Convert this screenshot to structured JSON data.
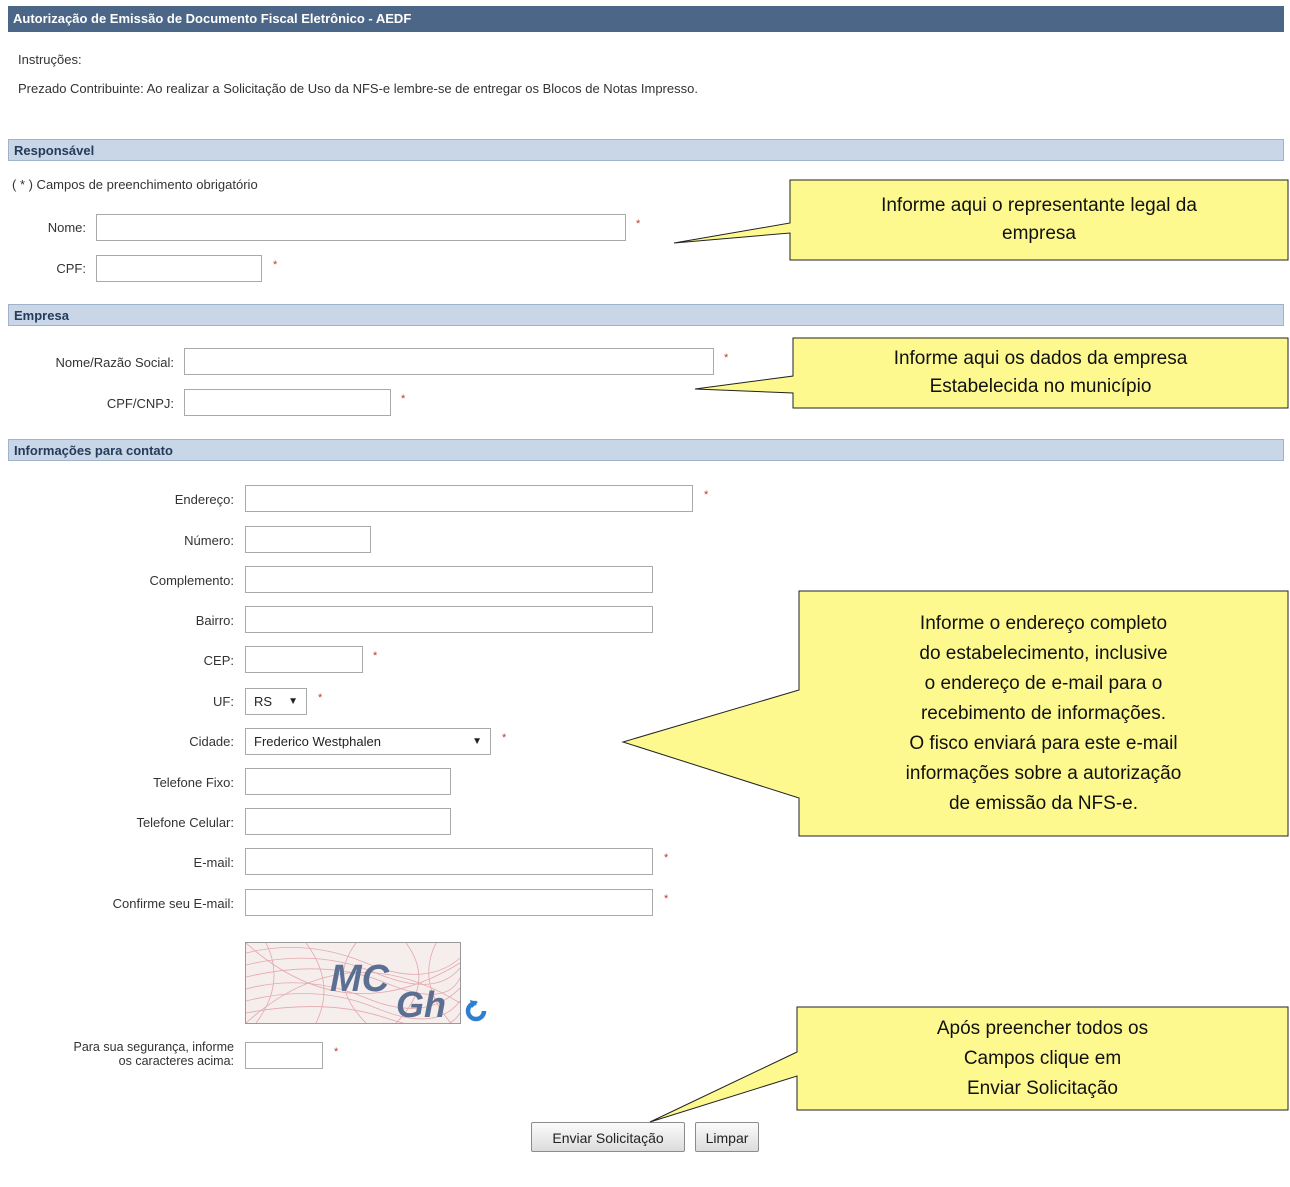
{
  "header": {
    "title": "Autorização de Emissão de Documento Fiscal Eletrônico - AEDF"
  },
  "instructions": {
    "label": "Instruções:",
    "text": "Prezado Contribuinte: Ao realizar a Solicitação de Uso da NFS-e lembre-se de entregar os Blocos de Notas Impresso."
  },
  "responsavel": {
    "section_title": "Responsável",
    "required_note": "( * ) Campos de preenchimento obrigatório",
    "nome_label": "Nome:",
    "cpf_label": "CPF:",
    "nome_value": "",
    "cpf_value": ""
  },
  "empresa": {
    "section_title": "Empresa",
    "razao_label": "Nome/Razão Social:",
    "cnpj_label": "CPF/CNPJ:",
    "razao_value": "",
    "cnpj_value": ""
  },
  "contato": {
    "section_title": "Informações para contato",
    "endereco_label": "Endereço:",
    "numero_label": "Número:",
    "complemento_label": "Complemento:",
    "bairro_label": "Bairro:",
    "cep_label": "CEP:",
    "uf_label": "UF:",
    "uf_value": "RS",
    "cidade_label": "Cidade:",
    "cidade_value": "Frederico Westphalen",
    "telefone_fixo_label": "Telefone Fixo:",
    "telefone_celular_label": "Telefone Celular:",
    "email_label": "E-mail:",
    "confirm_email_label": "Confirme seu E-mail:"
  },
  "captcha": {
    "image_text": "MCGh",
    "image_text_1": "MC",
    "image_text_2": "Gh",
    "refresh_icon": "refresh-icon",
    "label_line1": "Para sua segurança, informe",
    "label_line2": "os caracteres acima:",
    "value": ""
  },
  "required_mark": "*",
  "buttons": {
    "submit": "Enviar Solicitação",
    "clear": "Limpar"
  },
  "callouts": {
    "responsavel": [
      "Informe aqui o representante legal da",
      "empresa"
    ],
    "empresa": [
      "Informe aqui os dados da empresa",
      "Estabelecida no município"
    ],
    "contato": [
      "Informe o endereço completo",
      "do estabelecimento, inclusive",
      "o endereço de e-mail para o",
      "recebimento de informações.",
      "O fisco enviará para este e-mail",
      "informações sobre a autorização",
      "de emissão da NFS-e."
    ],
    "enviar": [
      "Após preencher todos os",
      "Campos clique em",
      "Enviar Solicitação"
    ]
  },
  "colors": {
    "header_bg": "#4b6687",
    "section_bg": "#c8d6e8",
    "callout_bg": "#fdf98f",
    "required": "#c0392b"
  }
}
